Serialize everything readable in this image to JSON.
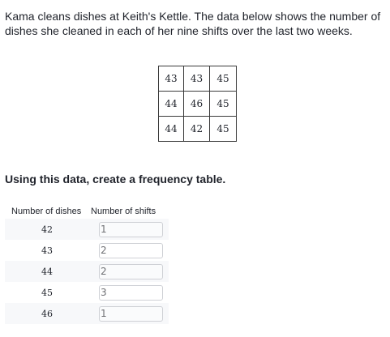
{
  "problem": {
    "text": "Kama cleans dishes at Keith's Kettle. The data below shows the number of dishes she cleaned in each of her nine shifts over the last two weeks."
  },
  "data_grid": {
    "rows": [
      [
        "43",
        "43",
        "45"
      ],
      [
        "44",
        "46",
        "45"
      ],
      [
        "44",
        "42",
        "45"
      ]
    ]
  },
  "prompt": {
    "text": "Using this data, create a frequency table."
  },
  "frequency_table": {
    "headers": [
      "Number of dishes",
      "Number of shifts"
    ],
    "rows": [
      {
        "dishes": "42",
        "shifts": "1"
      },
      {
        "dishes": "43",
        "shifts": "2"
      },
      {
        "dishes": "44",
        "shifts": "2"
      },
      {
        "dishes": "45",
        "shifts": "3"
      },
      {
        "dishes": "46",
        "shifts": "1"
      }
    ]
  }
}
